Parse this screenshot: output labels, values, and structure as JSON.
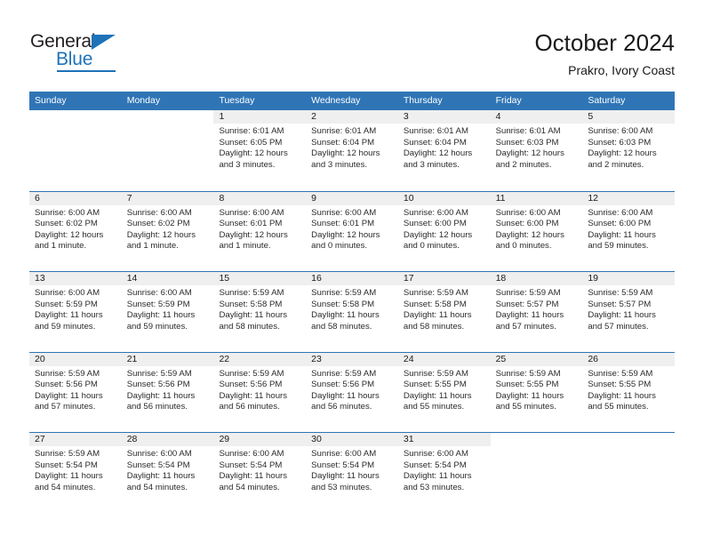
{
  "brand": {
    "word_one": "General",
    "word_two": "Blue",
    "triangle_icon": "blue-triangle-icon",
    "accent_color": "#1d72b8"
  },
  "header": {
    "title": "October 2024",
    "subtitle": "Prakro, Ivory Coast"
  },
  "theme": {
    "header_blue": "#2f75b6",
    "date_band_gray": "#efefef",
    "text": "#1a1a1a"
  },
  "calendar": {
    "day_names": [
      "Sunday",
      "Monday",
      "Tuesday",
      "Wednesday",
      "Thursday",
      "Friday",
      "Saturday"
    ],
    "weeks": [
      [
        {
          "day": "",
          "lines": []
        },
        {
          "day": "",
          "lines": []
        },
        {
          "day": "1",
          "lines": [
            "Sunrise: 6:01 AM",
            "Sunset: 6:05 PM",
            "Daylight: 12 hours",
            "and 3 minutes."
          ]
        },
        {
          "day": "2",
          "lines": [
            "Sunrise: 6:01 AM",
            "Sunset: 6:04 PM",
            "Daylight: 12 hours",
            "and 3 minutes."
          ]
        },
        {
          "day": "3",
          "lines": [
            "Sunrise: 6:01 AM",
            "Sunset: 6:04 PM",
            "Daylight: 12 hours",
            "and 3 minutes."
          ]
        },
        {
          "day": "4",
          "lines": [
            "Sunrise: 6:01 AM",
            "Sunset: 6:03 PM",
            "Daylight: 12 hours",
            "and 2 minutes."
          ]
        },
        {
          "day": "5",
          "lines": [
            "Sunrise: 6:00 AM",
            "Sunset: 6:03 PM",
            "Daylight: 12 hours",
            "and 2 minutes."
          ]
        }
      ],
      [
        {
          "day": "6",
          "lines": [
            "Sunrise: 6:00 AM",
            "Sunset: 6:02 PM",
            "Daylight: 12 hours",
            "and 1 minute."
          ]
        },
        {
          "day": "7",
          "lines": [
            "Sunrise: 6:00 AM",
            "Sunset: 6:02 PM",
            "Daylight: 12 hours",
            "and 1 minute."
          ]
        },
        {
          "day": "8",
          "lines": [
            "Sunrise: 6:00 AM",
            "Sunset: 6:01 PM",
            "Daylight: 12 hours",
            "and 1 minute."
          ]
        },
        {
          "day": "9",
          "lines": [
            "Sunrise: 6:00 AM",
            "Sunset: 6:01 PM",
            "Daylight: 12 hours",
            "and 0 minutes."
          ]
        },
        {
          "day": "10",
          "lines": [
            "Sunrise: 6:00 AM",
            "Sunset: 6:00 PM",
            "Daylight: 12 hours",
            "and 0 minutes."
          ]
        },
        {
          "day": "11",
          "lines": [
            "Sunrise: 6:00 AM",
            "Sunset: 6:00 PM",
            "Daylight: 12 hours",
            "and 0 minutes."
          ]
        },
        {
          "day": "12",
          "lines": [
            "Sunrise: 6:00 AM",
            "Sunset: 6:00 PM",
            "Daylight: 11 hours",
            "and 59 minutes."
          ]
        }
      ],
      [
        {
          "day": "13",
          "lines": [
            "Sunrise: 6:00 AM",
            "Sunset: 5:59 PM",
            "Daylight: 11 hours",
            "and 59 minutes."
          ]
        },
        {
          "day": "14",
          "lines": [
            "Sunrise: 6:00 AM",
            "Sunset: 5:59 PM",
            "Daylight: 11 hours",
            "and 59 minutes."
          ]
        },
        {
          "day": "15",
          "lines": [
            "Sunrise: 5:59 AM",
            "Sunset: 5:58 PM",
            "Daylight: 11 hours",
            "and 58 minutes."
          ]
        },
        {
          "day": "16",
          "lines": [
            "Sunrise: 5:59 AM",
            "Sunset: 5:58 PM",
            "Daylight: 11 hours",
            "and 58 minutes."
          ]
        },
        {
          "day": "17",
          "lines": [
            "Sunrise: 5:59 AM",
            "Sunset: 5:58 PM",
            "Daylight: 11 hours",
            "and 58 minutes."
          ]
        },
        {
          "day": "18",
          "lines": [
            "Sunrise: 5:59 AM",
            "Sunset: 5:57 PM",
            "Daylight: 11 hours",
            "and 57 minutes."
          ]
        },
        {
          "day": "19",
          "lines": [
            "Sunrise: 5:59 AM",
            "Sunset: 5:57 PM",
            "Daylight: 11 hours",
            "and 57 minutes."
          ]
        }
      ],
      [
        {
          "day": "20",
          "lines": [
            "Sunrise: 5:59 AM",
            "Sunset: 5:56 PM",
            "Daylight: 11 hours",
            "and 57 minutes."
          ]
        },
        {
          "day": "21",
          "lines": [
            "Sunrise: 5:59 AM",
            "Sunset: 5:56 PM",
            "Daylight: 11 hours",
            "and 56 minutes."
          ]
        },
        {
          "day": "22",
          "lines": [
            "Sunrise: 5:59 AM",
            "Sunset: 5:56 PM",
            "Daylight: 11 hours",
            "and 56 minutes."
          ]
        },
        {
          "day": "23",
          "lines": [
            "Sunrise: 5:59 AM",
            "Sunset: 5:56 PM",
            "Daylight: 11 hours",
            "and 56 minutes."
          ]
        },
        {
          "day": "24",
          "lines": [
            "Sunrise: 5:59 AM",
            "Sunset: 5:55 PM",
            "Daylight: 11 hours",
            "and 55 minutes."
          ]
        },
        {
          "day": "25",
          "lines": [
            "Sunrise: 5:59 AM",
            "Sunset: 5:55 PM",
            "Daylight: 11 hours",
            "and 55 minutes."
          ]
        },
        {
          "day": "26",
          "lines": [
            "Sunrise: 5:59 AM",
            "Sunset: 5:55 PM",
            "Daylight: 11 hours",
            "and 55 minutes."
          ]
        }
      ],
      [
        {
          "day": "27",
          "lines": [
            "Sunrise: 5:59 AM",
            "Sunset: 5:54 PM",
            "Daylight: 11 hours",
            "and 54 minutes."
          ]
        },
        {
          "day": "28",
          "lines": [
            "Sunrise: 6:00 AM",
            "Sunset: 5:54 PM",
            "Daylight: 11 hours",
            "and 54 minutes."
          ]
        },
        {
          "day": "29",
          "lines": [
            "Sunrise: 6:00 AM",
            "Sunset: 5:54 PM",
            "Daylight: 11 hours",
            "and 54 minutes."
          ]
        },
        {
          "day": "30",
          "lines": [
            "Sunrise: 6:00 AM",
            "Sunset: 5:54 PM",
            "Daylight: 11 hours",
            "and 53 minutes."
          ]
        },
        {
          "day": "31",
          "lines": [
            "Sunrise: 6:00 AM",
            "Sunset: 5:54 PM",
            "Daylight: 11 hours",
            "and 53 minutes."
          ]
        },
        {
          "day": "",
          "lines": []
        },
        {
          "day": "",
          "lines": []
        }
      ]
    ]
  }
}
